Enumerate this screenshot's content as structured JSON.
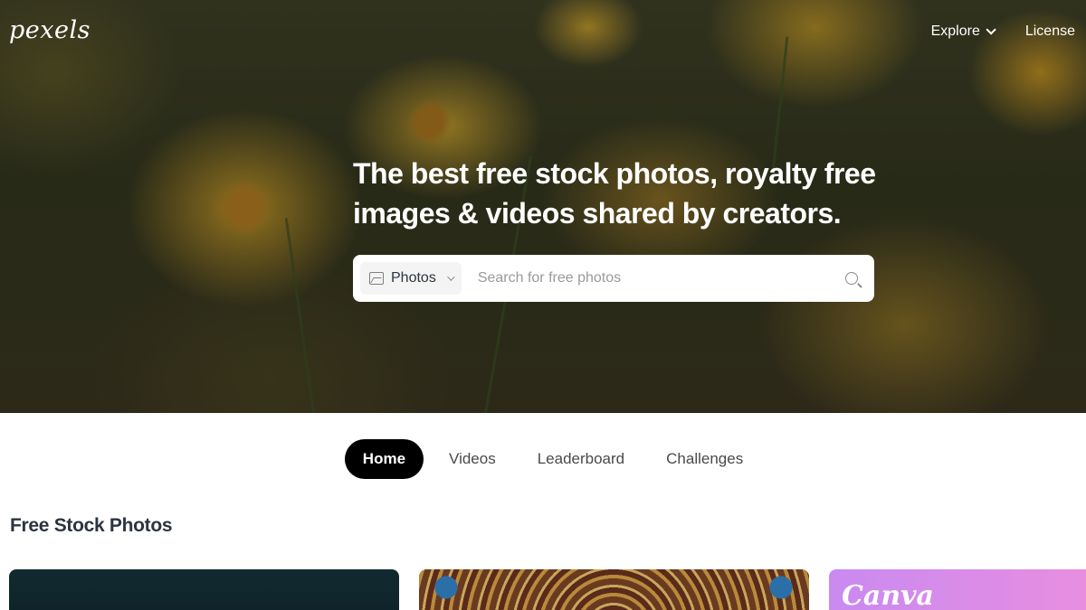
{
  "brand": {
    "logo": "pexels"
  },
  "topnav": {
    "explore_label": "Explore",
    "license_label": "License"
  },
  "hero": {
    "headline": "The best free stock photos, royalty free images & videos shared by creators."
  },
  "search": {
    "type_label": "Photos",
    "placeholder": "Search for free photos",
    "value": ""
  },
  "tabs": [
    {
      "label": "Home",
      "active": true
    },
    {
      "label": "Videos",
      "active": false
    },
    {
      "label": "Leaderboard",
      "active": false
    },
    {
      "label": "Challenges",
      "active": false
    }
  ],
  "section": {
    "title": "Free Stock Photos"
  },
  "cards": [
    {
      "label": ""
    },
    {
      "label": ""
    },
    {
      "label": "Canva"
    }
  ],
  "colors": {
    "accent": "#000000",
    "text": "#2c343e",
    "background": "#ffffff"
  },
  "icons": [
    "image-icon",
    "chevron-down-icon",
    "search-icon"
  ]
}
